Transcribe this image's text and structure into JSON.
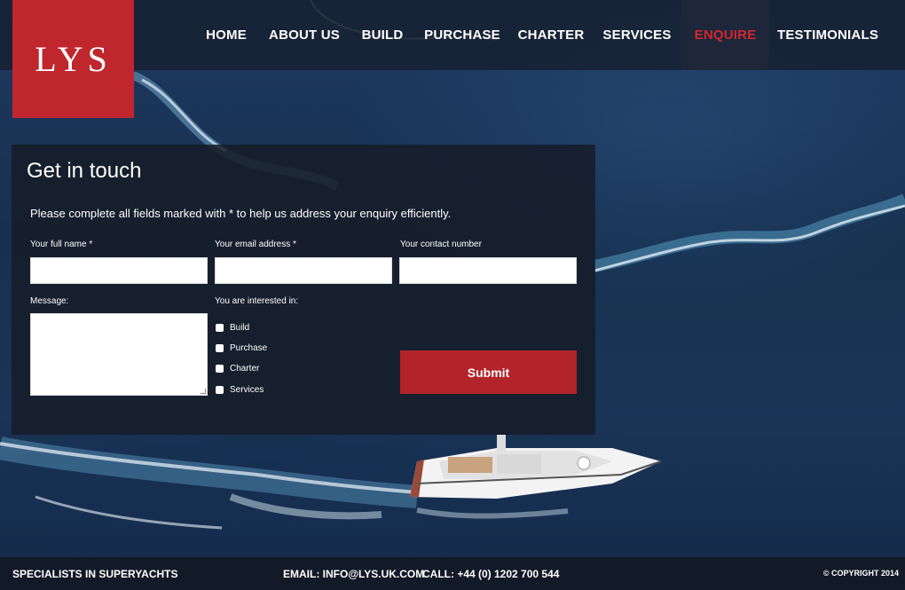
{
  "brand": {
    "logo_text": "LYS"
  },
  "nav": {
    "items": [
      {
        "label": "HOME"
      },
      {
        "label": "ABOUT US"
      },
      {
        "label": "BUILD"
      },
      {
        "label": "PURCHASE"
      },
      {
        "label": "CHARTER"
      },
      {
        "label": "SERVICES"
      },
      {
        "label": "ENQUIRE"
      },
      {
        "label": "TESTIMONIALS"
      }
    ],
    "active": "ENQUIRE"
  },
  "form": {
    "title": "Get in touch",
    "intro": "Please complete all fields marked with * to help us address your enquiry efficiently.",
    "fields": {
      "name_label": "Your full name *",
      "name_value": "",
      "email_label": "Your email address *",
      "email_value": "",
      "phone_label": "Your contact number",
      "phone_value": "",
      "message_label": "Message:",
      "message_value": ""
    },
    "interests_label": "You are interested in:",
    "interests": [
      {
        "label": "Build",
        "checked": false
      },
      {
        "label": "Purchase",
        "checked": false
      },
      {
        "label": "Charter",
        "checked": false
      },
      {
        "label": "Services",
        "checked": false
      }
    ],
    "submit_label": "Submit"
  },
  "footer": {
    "tagline": "SPECIALISTS IN SUPERYACHTS",
    "email": "EMAIL: INFO@LYS.UK.COM",
    "phone": "CALL: +44 (0) 1202 700 544",
    "copyright": "© COPYRIGHT 2014"
  },
  "colors": {
    "accent": "#c0262d",
    "button": "#b3232a",
    "panel": "#161c28",
    "ocean": "#1a3557"
  }
}
